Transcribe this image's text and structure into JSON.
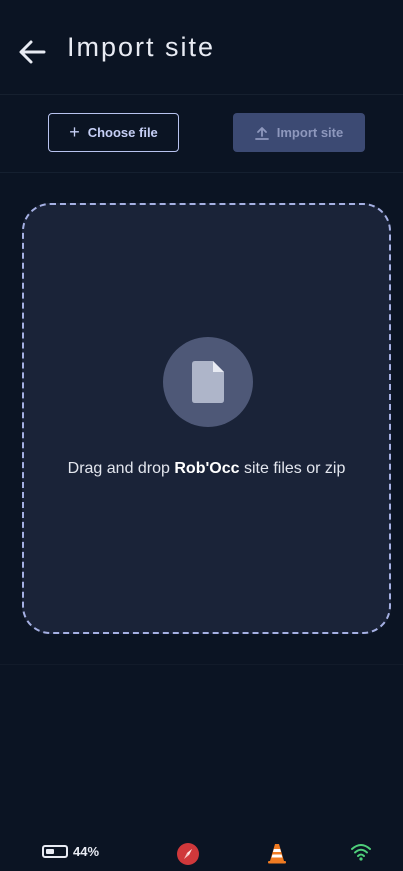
{
  "header": {
    "title": "Import site"
  },
  "toolbar": {
    "choose_file_label": "Choose file",
    "import_site_label": "Import site",
    "import_site_disabled": true
  },
  "dropzone": {
    "text_before": "Drag and drop ",
    "brand": "Rob'Occ",
    "text_after": " site files or zip"
  },
  "status_bar": {
    "battery_percent_label": "44%",
    "battery_level": 0.44,
    "icons": [
      "battery-icon",
      "compass-icon",
      "cone-icon",
      "wifi-icon"
    ],
    "colors": {
      "compass": "#d0383b",
      "cone": "#f07b22",
      "wifi": "#4fd07b"
    }
  },
  "colors": {
    "background": "#0b1423",
    "dropzone_bg": "#1a2338",
    "accent": "#b8c3ef",
    "disabled_button": "#3c4a73"
  }
}
